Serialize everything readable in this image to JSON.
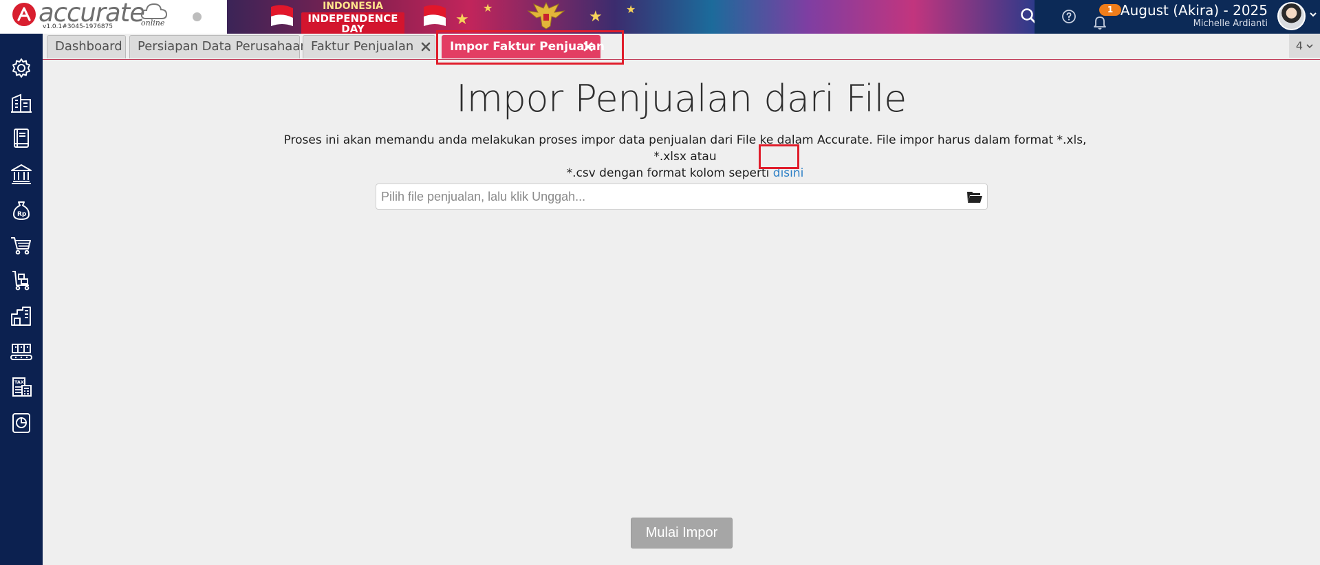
{
  "header": {
    "logo_text": "accurate",
    "logo_suffix": "online",
    "version": "v1.0.1#3045-1976875",
    "banner_line1": "INDONESIA",
    "banner_line2": "INDEPENDENCE DAY",
    "notification_count": "1",
    "period": "August (Akira) - 2025",
    "user_name": "Michelle Ardianti"
  },
  "sidebar": {
    "items": [
      {
        "icon": "gear-icon"
      },
      {
        "icon": "company-building-icon"
      },
      {
        "icon": "ledger-book-icon"
      },
      {
        "icon": "bank-icon"
      },
      {
        "icon": "money-bag-icon"
      },
      {
        "icon": "shopping-cart-icon"
      },
      {
        "icon": "sales-cart-icon"
      },
      {
        "icon": "warehouse-icon"
      },
      {
        "icon": "manufacturing-icon"
      },
      {
        "icon": "tax-icon"
      },
      {
        "icon": "report-chart-icon"
      }
    ]
  },
  "tabs": [
    {
      "label": "Dashboard",
      "closable": false,
      "active": false
    },
    {
      "label": "Persiapan Data Perusahaan",
      "closable": false,
      "active": false
    },
    {
      "label": "Faktur Penjualan",
      "closable": true,
      "active": false
    },
    {
      "label": "Impor Faktur Penjualan",
      "closable": true,
      "active": true
    }
  ],
  "tab_count": "4",
  "main": {
    "title": "Impor Penjualan dari File",
    "description_line1": "Proses ini akan memandu anda melakukan proses impor data penjualan dari File ke dalam Accurate. File impor harus dalam format *.xls, *.xlsx atau",
    "description_line2": "*.csv dengan format kolom seperti",
    "link_text": "disini",
    "file_placeholder": "Pilih file penjualan, lalu klik Unggah...",
    "file_value": "",
    "start_button": "Mulai Impor"
  },
  "colors": {
    "sidebar_bg": "#0c2150",
    "active_tab": "#e33d63",
    "highlight": "#e01d2b",
    "link": "#2d80c6",
    "notification": "#f07d1a"
  }
}
